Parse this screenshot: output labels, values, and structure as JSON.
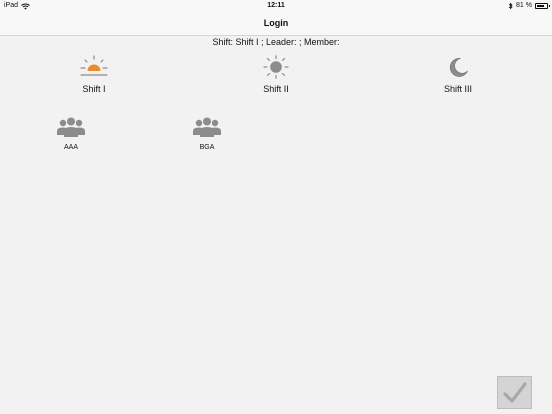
{
  "status_bar": {
    "device": "iPad",
    "time": "12:11",
    "battery": "81 %",
    "battery_level": 0.81
  },
  "nav": {
    "title": "Login"
  },
  "shift_info": "Shift: Shift I ; Leader: ; Member:",
  "shifts": [
    {
      "label": "Shift I",
      "icon": "sunrise-icon",
      "color": "#e88a2d"
    },
    {
      "label": "Shift II",
      "icon": "sun-icon",
      "color": "#8c8c8c"
    },
    {
      "label": "Shift III",
      "icon": "moon-icon",
      "color": "#8c8c8c"
    }
  ],
  "groups": [
    {
      "label": "AAA",
      "icon": "group-icon"
    },
    {
      "label": "BGA",
      "icon": "group-icon"
    }
  ],
  "confirm_icon": "checkmark-icon"
}
